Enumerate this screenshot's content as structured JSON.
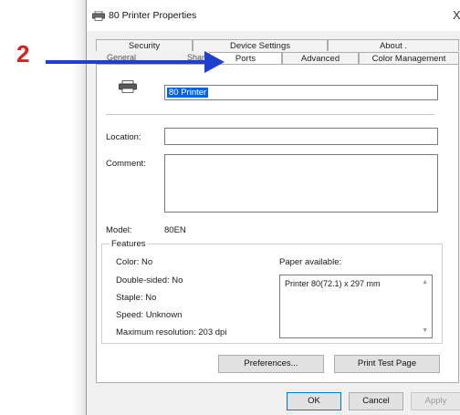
{
  "annotation": {
    "step_number": "2",
    "color": "#1f3fd1",
    "number_color": "#e02020"
  },
  "window": {
    "title": "80 Printer Properties",
    "close_glyph": "X"
  },
  "tabs": {
    "row1": [
      {
        "label": "Security"
      },
      {
        "label": "Device Settings"
      },
      {
        "label": "About ."
      }
    ],
    "row2": [
      {
        "label": "Ports",
        "active": true
      },
      {
        "label": "Advanced"
      },
      {
        "label": "Color Management"
      }
    ],
    "overlap_labels": [
      "General",
      "Sharing"
    ]
  },
  "general": {
    "printer_name": "80 Printer",
    "location_label": "Location:",
    "location_value": "",
    "comment_label": "Comment:",
    "comment_value": "",
    "model_label": "Model:",
    "model_value": "80EN",
    "features": {
      "legend": "Features",
      "color": "Color: No",
      "double_sided": "Double-sided: No",
      "staple": "Staple: No",
      "speed": "Speed: Unknown",
      "max_resolution": "Maximum resolution: 203 dpi",
      "paper_label": "Paper available:",
      "paper_items": [
        "Printer 80(72.1) x 297 mm"
      ]
    },
    "preferences_button": "Preferences...",
    "print_test_button": "Print Test Page"
  },
  "footer": {
    "ok": "OK",
    "cancel": "Cancel",
    "apply": "Apply"
  }
}
